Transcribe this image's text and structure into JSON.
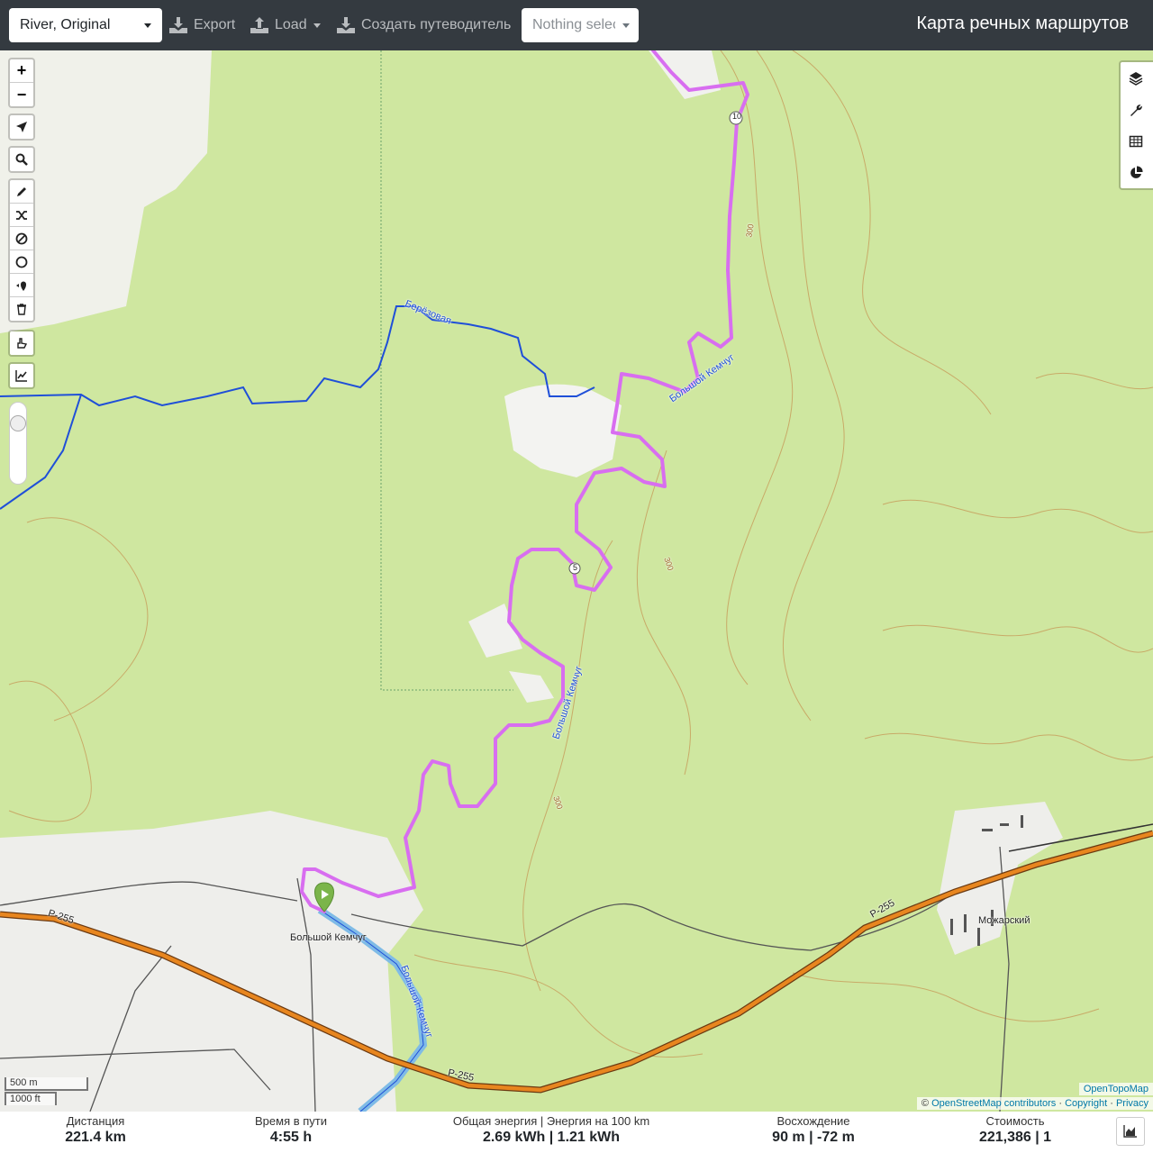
{
  "header": {
    "profile": "River, Original",
    "export_label": "Export",
    "load_label": "Load",
    "guide_label": "Создать путеводитель",
    "selection": "Nothing selected",
    "brand": "Карта речных маршрутов"
  },
  "map": {
    "zoom_in": "+",
    "zoom_out": "−",
    "place_labels": {
      "village1": "Большой Кемчуг",
      "village2": "Можарский",
      "road1": "Р-255",
      "road2": "Р-255",
      "road3": "Р-255",
      "river1": "Большой Кемчуг",
      "river2": "Большой Кемчуг",
      "river3": "Большой Кемчуг",
      "stream": "Берёзовая",
      "km10": "10",
      "km5": "5"
    },
    "contour_label": "300",
    "scale": {
      "metric": "500 m",
      "imperial": "1000 ft"
    },
    "attribution": {
      "tiles": "OpenTopoMap",
      "prefix": "©",
      "osm": "OpenStreetMap contributors",
      "sep1": "·",
      "copyright": "Copyright",
      "sep2": "·",
      "privacy": "Privacy"
    },
    "colors": {
      "route": "#d86ef0",
      "river": "#1f4fd8",
      "highway": "#e8861f",
      "terrain": "#cfe7a0"
    }
  },
  "stats": {
    "distance_label": "Дистанция",
    "distance_value": "221.4 km",
    "time_label": "Время в пути",
    "time_value": "4:55 h",
    "energy_label": "Общая энергия | Энергия на 100 km",
    "energy_value": "2.69 kWh | 1.21 kWh",
    "ascent_label": "Восхождение",
    "ascent_value": "90 m | -72 m",
    "cost_label": "Стоимость",
    "cost_value": "221,386 | 1"
  }
}
